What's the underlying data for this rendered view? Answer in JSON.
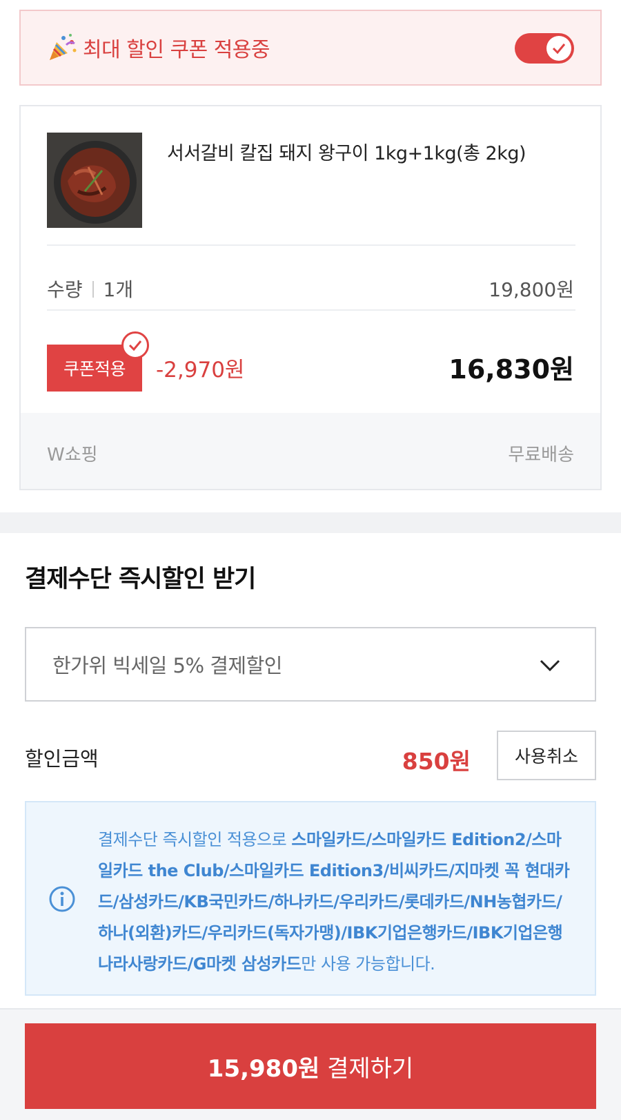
{
  "coupon_banner": {
    "label": "최대 할인 쿠폰 적용중",
    "toggle_on": true,
    "icon": "party-popper-icon"
  },
  "product": {
    "name": "서서갈비 칼집 돼지 왕구이 1kg+1kg(총 2kg)",
    "qty_label": "수량",
    "qty_value": "1개",
    "original_price": "19,800원",
    "coupon_badge": "쿠폰적용",
    "discount": "-2,970원",
    "final_price": "16,830원",
    "seller": "W쇼핑",
    "shipping": "무료배송"
  },
  "payment_discount": {
    "title": "결제수단 즉시할인 받기",
    "selected_option": "한가위 빅세일 5% 결제할인",
    "discount_label": "할인금액",
    "discount_amount": "850원",
    "cancel_label": "사용취소",
    "info_prefix": "결제수단 즉시할인 적용으로 ",
    "info_cards": "스마일카드/스마일카드 Edition2/스마일카드 the Club/스마일카드 Edition3/비씨카드/지마켓 꼭 현대카드/삼성카드/KB국민카드/하나카드/우리카드/롯데카드/NH농협카드/하나(외환)카드/우리카드(독자가맹)/IBK기업은행카드/IBK기업은행 나라사랑카드/G마켓 삼성카드",
    "info_suffix": "만 사용 가능합니다."
  },
  "pay_button": {
    "amount": "15,980원",
    "label": " 결제하기"
  },
  "colors": {
    "accent": "#d9403f",
    "info_blue": "#4a90d6"
  }
}
